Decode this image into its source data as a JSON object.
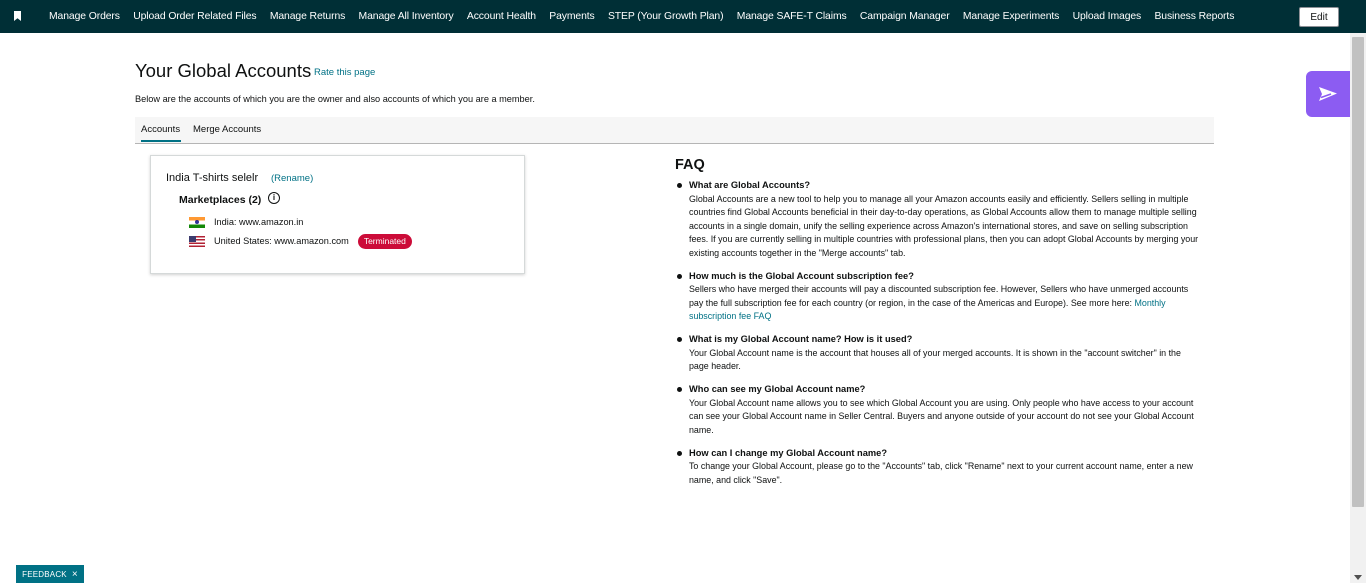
{
  "nav": {
    "items": [
      "Manage Orders",
      "Upload Order Related Files",
      "Manage Returns",
      "Manage All Inventory",
      "Account Health",
      "Payments",
      "STEP (Your Growth Plan)",
      "Manage SAFE-T Claims",
      "Campaign Manager",
      "Manage Experiments",
      "Upload Images",
      "Business Reports"
    ],
    "edit_label": "Edit"
  },
  "header": {
    "title": "Your Global Accounts",
    "rate_link": "Rate this page",
    "subtitle": "Below are the accounts of which you are the owner and also accounts of which you are a member."
  },
  "tabs": [
    {
      "label": "Accounts",
      "active": true
    },
    {
      "label": "Merge Accounts",
      "active": false
    }
  ],
  "account": {
    "name": "India T-shirts selelr",
    "rename_label": "(Rename)",
    "marketplaces_title": "Marketplaces (2)",
    "info_icon": "info-icon",
    "marketplaces": [
      {
        "flag": "india-flag-icon",
        "label": "India: www.amazon.in",
        "badge": ""
      },
      {
        "flag": "us-flag-icon",
        "label": "United States: www.amazon.com",
        "badge": "Terminated"
      }
    ]
  },
  "faq": {
    "title": "FAQ",
    "items": [
      {
        "q": "What are Global Accounts?",
        "a": "Global Accounts are a new tool to help you to manage all your Amazon accounts easily and efficiently. Sellers selling in multiple countries find Global Accounts beneficial in their day-to-day operations, as Global Accounts allow them to manage multiple selling accounts in a single domain, unify the selling experience across Amazon's international stores, and save on selling subscription fees. If you are currently selling in multiple countries with professional plans, then you can adopt Global Accounts by merging your existing accounts together in the \"Merge accounts\" tab.",
        "link": ""
      },
      {
        "q": "How much is the Global Account subscription fee?",
        "a": "Sellers who have merged their accounts will pay a discounted subscription fee. However, Sellers who have unmerged accounts pay the full subscription fee for each country (or region, in the case of the Americas and Europe). See more here: ",
        "link": "Monthly subscription fee FAQ"
      },
      {
        "q": "What is my Global Account name? How is it used?",
        "a": "Your Global Account name is the account that houses all of your merged accounts. It is shown in the \"account switcher\" in the page header.",
        "link": ""
      },
      {
        "q": "Who can see my Global Account name?",
        "a": "Your Global Account name allows you to see which Global Account you are using. Only people who have access to your account can see your Global Account name in Seller Central. Buyers and anyone outside of your account do not see your Global Account name.",
        "link": ""
      },
      {
        "q": "How can I change my Global Account name?",
        "a": "To change your Global Account, please go to the \"Accounts\" tab, click \"Rename\" next to your current account name, enter a new name, and click \"Save\".",
        "link": ""
      }
    ]
  },
  "feedback": {
    "label": "FEEDBACK",
    "close": "×"
  },
  "colors": {
    "topbar": "#002f36",
    "link": "#007185",
    "badge": "#cc0c39",
    "float_button": "#8c5cf2"
  }
}
